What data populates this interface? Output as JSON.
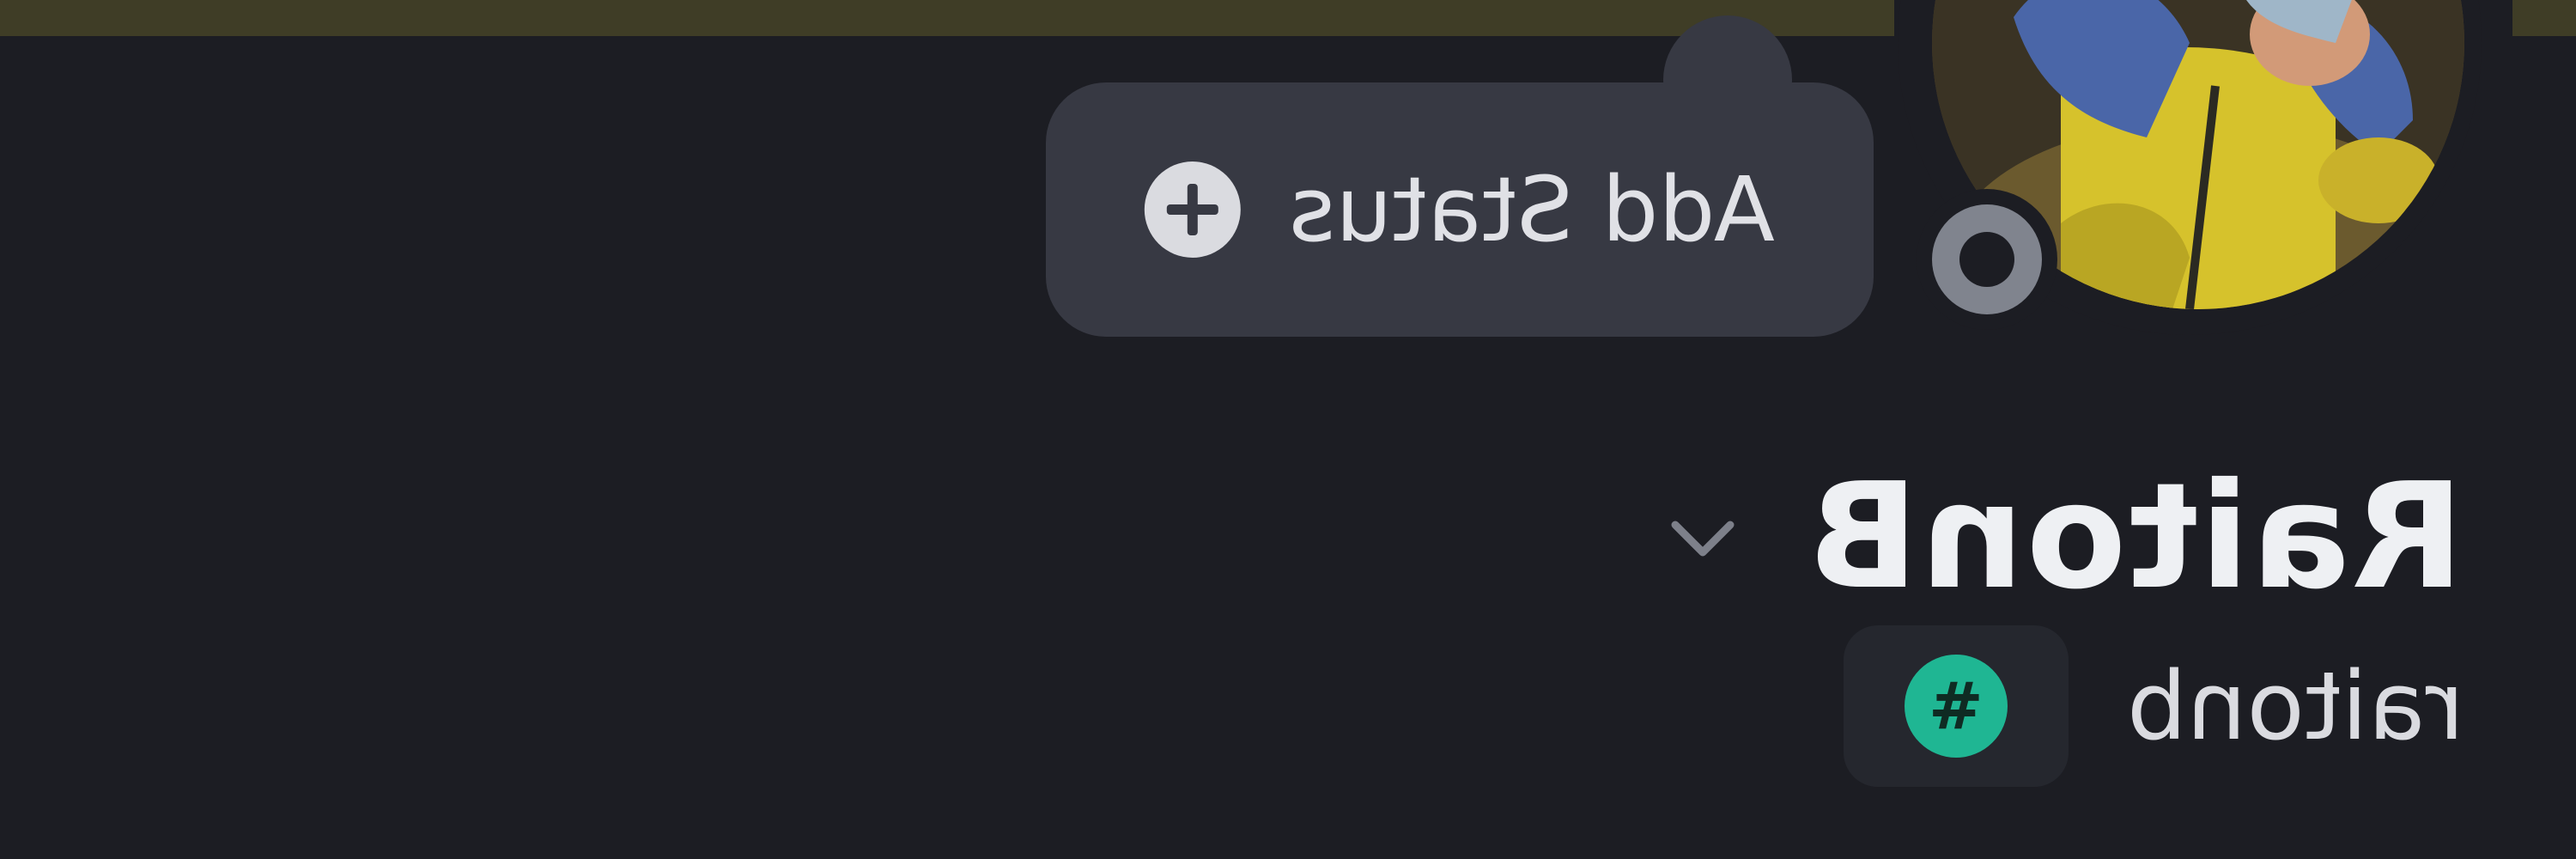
{
  "status_bubble": {
    "label": "Add Status",
    "icon": "plus-circle-icon"
  },
  "profile": {
    "display_name": "RaitonB",
    "username": "raitonb",
    "username_badge_icon": "hash-icon",
    "username_badge_glyph": "#",
    "presence": "offline",
    "expand_icon": "chevron-down-icon"
  },
  "colors": {
    "background": "#1c1d23",
    "banner": "#3f3d26",
    "bubble": "#373943",
    "badge_green": "#1fb693",
    "presence_gray": "#80848e"
  }
}
